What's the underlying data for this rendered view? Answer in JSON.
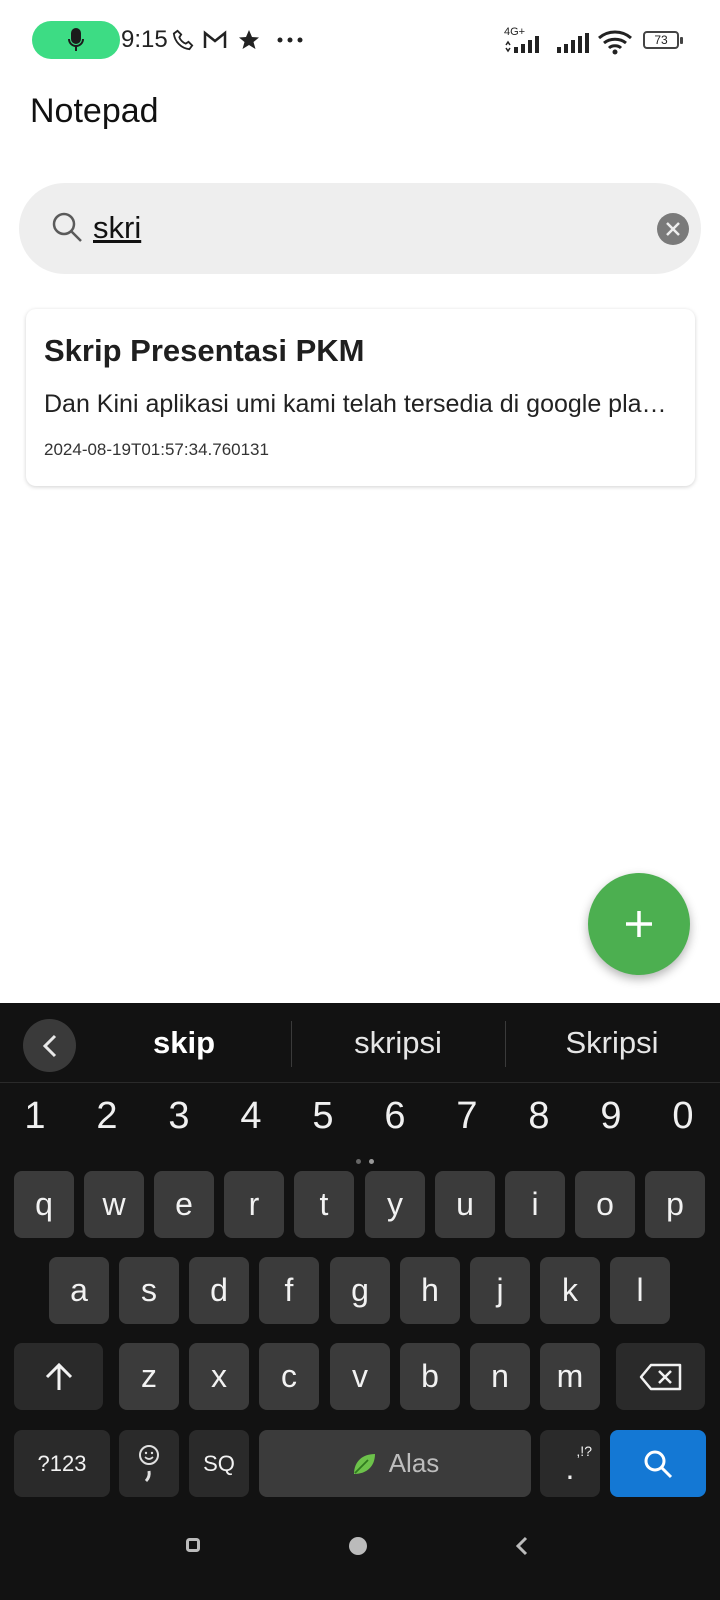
{
  "status_bar": {
    "time": "9:15",
    "network": "4G+",
    "battery": "73"
  },
  "app": {
    "title": "Notepad"
  },
  "search": {
    "value": "skri",
    "placeholder": ""
  },
  "notes": [
    {
      "title": "Skrip Presentasi PKM",
      "body": "Dan Kini aplikasi umi kami telah tersedia di google playstore",
      "date": "2024-08-19T01:57:34.760131"
    }
  ],
  "fab": {
    "icon": "plus-icon",
    "color": "#4caf50"
  },
  "keyboard": {
    "suggestions": [
      "skip",
      "skripsi",
      "Skripsi"
    ],
    "numbers": [
      "1",
      "2",
      "3",
      "4",
      "5",
      "6",
      "7",
      "8",
      "9",
      "0"
    ],
    "row1": [
      "q",
      "w",
      "e",
      "r",
      "t",
      "y",
      "u",
      "i",
      "o",
      "p"
    ],
    "row2": [
      "a",
      "s",
      "d",
      "f",
      "g",
      "h",
      "j",
      "k",
      "l"
    ],
    "row3": [
      "z",
      "x",
      "c",
      "v",
      "b",
      "n",
      "m"
    ],
    "symbols_label": "?123",
    "lang_label": "SQ",
    "space_label": "Alas",
    "period_label": ".",
    "period_alt": ",!?",
    "action_color": "#1478d4"
  }
}
